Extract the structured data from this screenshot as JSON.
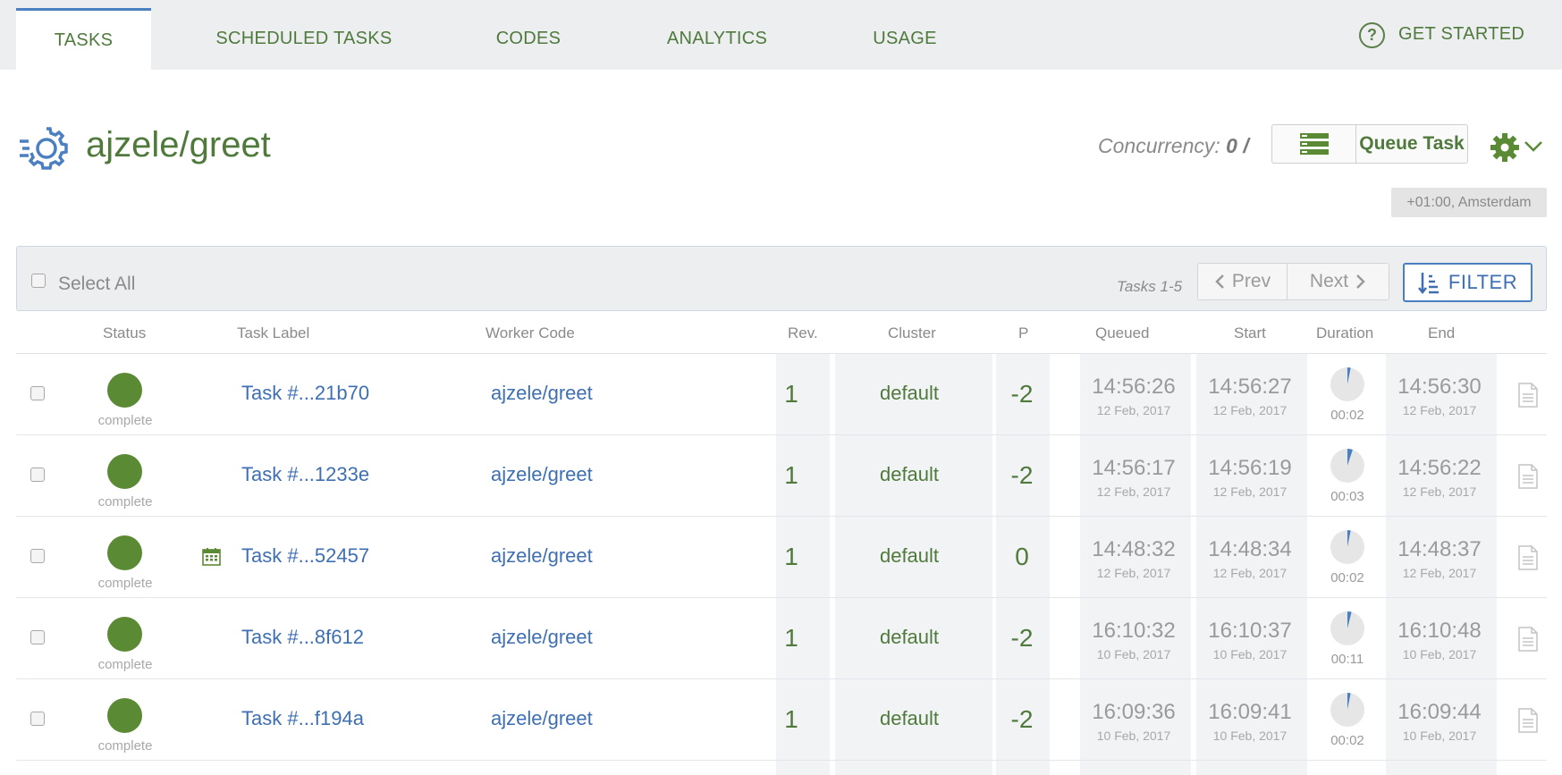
{
  "nav": {
    "tabs": [
      {
        "label": "TASKS",
        "active": true
      },
      {
        "label": "SCHEDULED TASKS",
        "active": false
      },
      {
        "label": "CODES",
        "active": false
      },
      {
        "label": "ANALYTICS",
        "active": false
      },
      {
        "label": "USAGE",
        "active": false
      }
    ],
    "help_glyph": "?",
    "get_started": "GET STARTED"
  },
  "header": {
    "title": "ajzele/greet",
    "concurrency_label": "Concurrency:",
    "concurrency_value": "0 /",
    "queue_task": "Queue Task",
    "timezone": "+01:00, Amsterdam"
  },
  "toolbar": {
    "select_all": "Select All",
    "tasks_range": "Tasks 1-5",
    "prev": "Prev",
    "next": "Next",
    "filter": "FILTER"
  },
  "table": {
    "columns": {
      "status": "Status",
      "task_label": "Task Label",
      "worker_code": "Worker Code",
      "rev": "Rev.",
      "cluster": "Cluster",
      "priority": "P",
      "queued": "Queued",
      "start": "Start",
      "duration": "Duration",
      "end": "End"
    },
    "rows": [
      {
        "status": "complete",
        "scheduled": false,
        "label": "Task #...21b70",
        "code": "ajzele/greet",
        "rev": "1",
        "cluster": "default",
        "priority": "-2",
        "queued_time": "14:56:26",
        "queued_date": "12 Feb, 2017",
        "start_time": "14:56:27",
        "start_date": "12 Feb, 2017",
        "duration": "00:02",
        "duration_fraction": 0.03,
        "end_time": "14:56:30",
        "end_date": "12 Feb, 2017"
      },
      {
        "status": "complete",
        "scheduled": false,
        "label": "Task #...1233e",
        "code": "ajzele/greet",
        "rev": "1",
        "cluster": "default",
        "priority": "-2",
        "queued_time": "14:56:17",
        "queued_date": "12 Feb, 2017",
        "start_time": "14:56:19",
        "start_date": "12 Feb, 2017",
        "duration": "00:03",
        "duration_fraction": 0.05,
        "end_time": "14:56:22",
        "end_date": "12 Feb, 2017"
      },
      {
        "status": "complete",
        "scheduled": true,
        "label": "Task #...52457",
        "code": "ajzele/greet",
        "rev": "1",
        "cluster": "default",
        "priority": "0",
        "queued_time": "14:48:32",
        "queued_date": "12 Feb, 2017",
        "start_time": "14:48:34",
        "start_date": "12 Feb, 2017",
        "duration": "00:02",
        "duration_fraction": 0.03,
        "end_time": "14:48:37",
        "end_date": "12 Feb, 2017"
      },
      {
        "status": "complete",
        "scheduled": false,
        "label": "Task #...8f612",
        "code": "ajzele/greet",
        "rev": "1",
        "cluster": "default",
        "priority": "-2",
        "queued_time": "16:10:32",
        "queued_date": "10 Feb, 2017",
        "start_time": "16:10:37",
        "start_date": "10 Feb, 2017",
        "duration": "00:11",
        "duration_fraction": 0.04,
        "end_time": "16:10:48",
        "end_date": "10 Feb, 2017"
      },
      {
        "status": "complete",
        "scheduled": false,
        "label": "Task #...f194a",
        "code": "ajzele/greet",
        "rev": "1",
        "cluster": "default",
        "priority": "-2",
        "queued_time": "16:09:36",
        "queued_date": "10 Feb, 2017",
        "start_time": "16:09:41",
        "start_date": "10 Feb, 2017",
        "duration": "00:02",
        "duration_fraction": 0.03,
        "end_time": "16:09:44",
        "end_date": "10 Feb, 2017"
      }
    ]
  },
  "colors": {
    "accent_blue": "#3f6fb3",
    "brand_green": "#4f7a3c",
    "status_complete": "#5b8a35",
    "duration_fill": "#4a7fc1",
    "duration_track": "#e6e6e6"
  }
}
